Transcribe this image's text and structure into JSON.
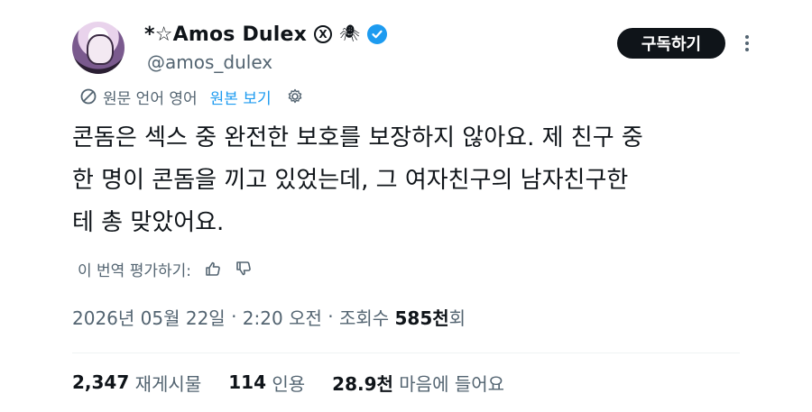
{
  "author": {
    "display_name": "*☆Amos Dulex",
    "x_badge": "X",
    "spider": "🕷",
    "handle": "@amos_dulex",
    "verified_icon": "verified-badge-icon",
    "accent_color": "#1d9bf0"
  },
  "header": {
    "subscribe_label": "구독하기"
  },
  "translation": {
    "note": "원문 언어 영어",
    "show_original": "원본 보기"
  },
  "tweet": {
    "text": "콘돔은 섹스 중 완전한 보호를 보장하지 않아요. 제 친구 중\n한 명이 콘돔을 끼고 있었는데, 그 여자친구의 남자친구한\n테 총 맞았어요."
  },
  "rating": {
    "label": "이 번역 평가하기:"
  },
  "meta": {
    "date": "2026년 05월 22일",
    "sep1": " · ",
    "time": "2:20 오전",
    "sep2": " · ",
    "views_label": "조회수 ",
    "views_count": "585천",
    "views_suffix": "회"
  },
  "stats": {
    "reposts_count": "2,347",
    "reposts_label": " 재게시물",
    "quotes_count": "114",
    "quotes_label": " 인용",
    "likes_count": "28.9천",
    "likes_label": " 마음에 들어요"
  }
}
